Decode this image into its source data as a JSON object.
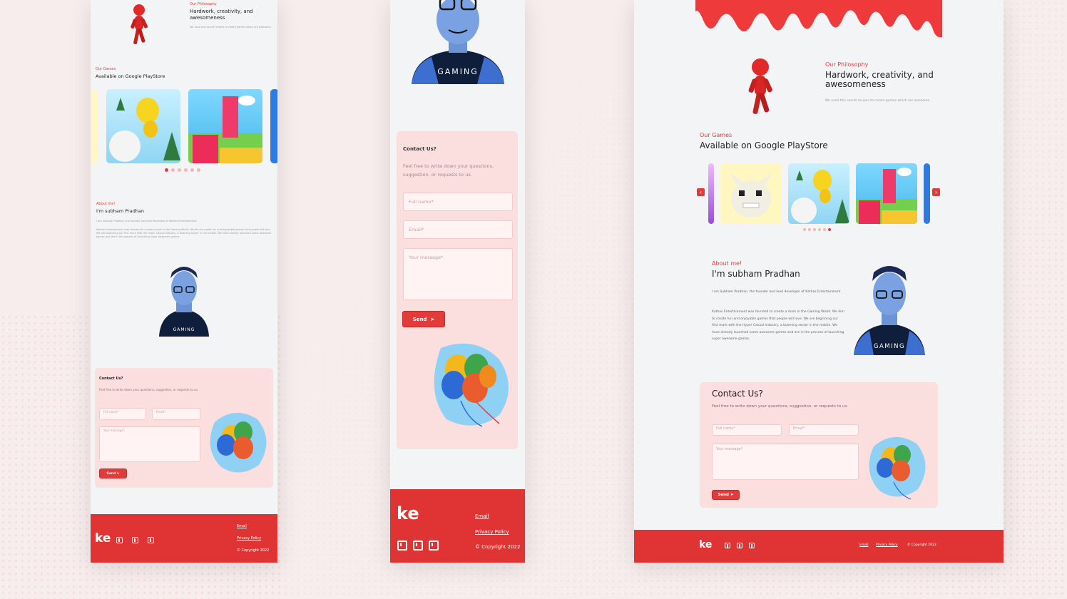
{
  "philosophy": {
    "label": "Our Philosophy",
    "title": "Hardwork, creativity, and awesomeness",
    "body": "We used this secret recipes to create games which are awesome."
  },
  "games": {
    "label": "Our Games",
    "title": "Available on Google PlayStore",
    "prev_icon": "chevron-left-icon",
    "next_icon": "chevron-right-icon",
    "slides_count": 6
  },
  "about": {
    "label": "About me!",
    "title_mobile": "I'm subham Pradhan",
    "title": "I'm subham Pradhan",
    "para1": "I am Subham Pradhan, the founder and lead developer of Kathas Entertainment.",
    "para2": "Kathas Entertainment was founded to create a mark in the Gaming World. We Aim to create fun and enjoyable games that people will love. We are beginning our first mark with the Hyper Casual Industry, a booming sector in the mobile. We have already launched some awesome games and are in the process of launching super awesome games.",
    "shirt_text": "GAMING"
  },
  "contact": {
    "title": "Contact Us?",
    "title_large": "Contact Us?",
    "body": "Feel free to write down your questions, suggestion, or requests to us.",
    "fullname_placeholder": "Full name*",
    "email_placeholder": "Email*",
    "message_placeholder": "Your message*",
    "send_label": "Send"
  },
  "footer": {
    "logo_text": "ke",
    "email_link": "Email",
    "privacy_link": "Privacy Policy",
    "copyright": "© Copyright 2022",
    "icons": [
      "facebook-icon",
      "linkedin-icon",
      "twitter-icon"
    ]
  },
  "colors": {
    "accent": "#e33a3a",
    "contact_bg": "#fbdede",
    "page_bg": "#f3f4f6"
  }
}
